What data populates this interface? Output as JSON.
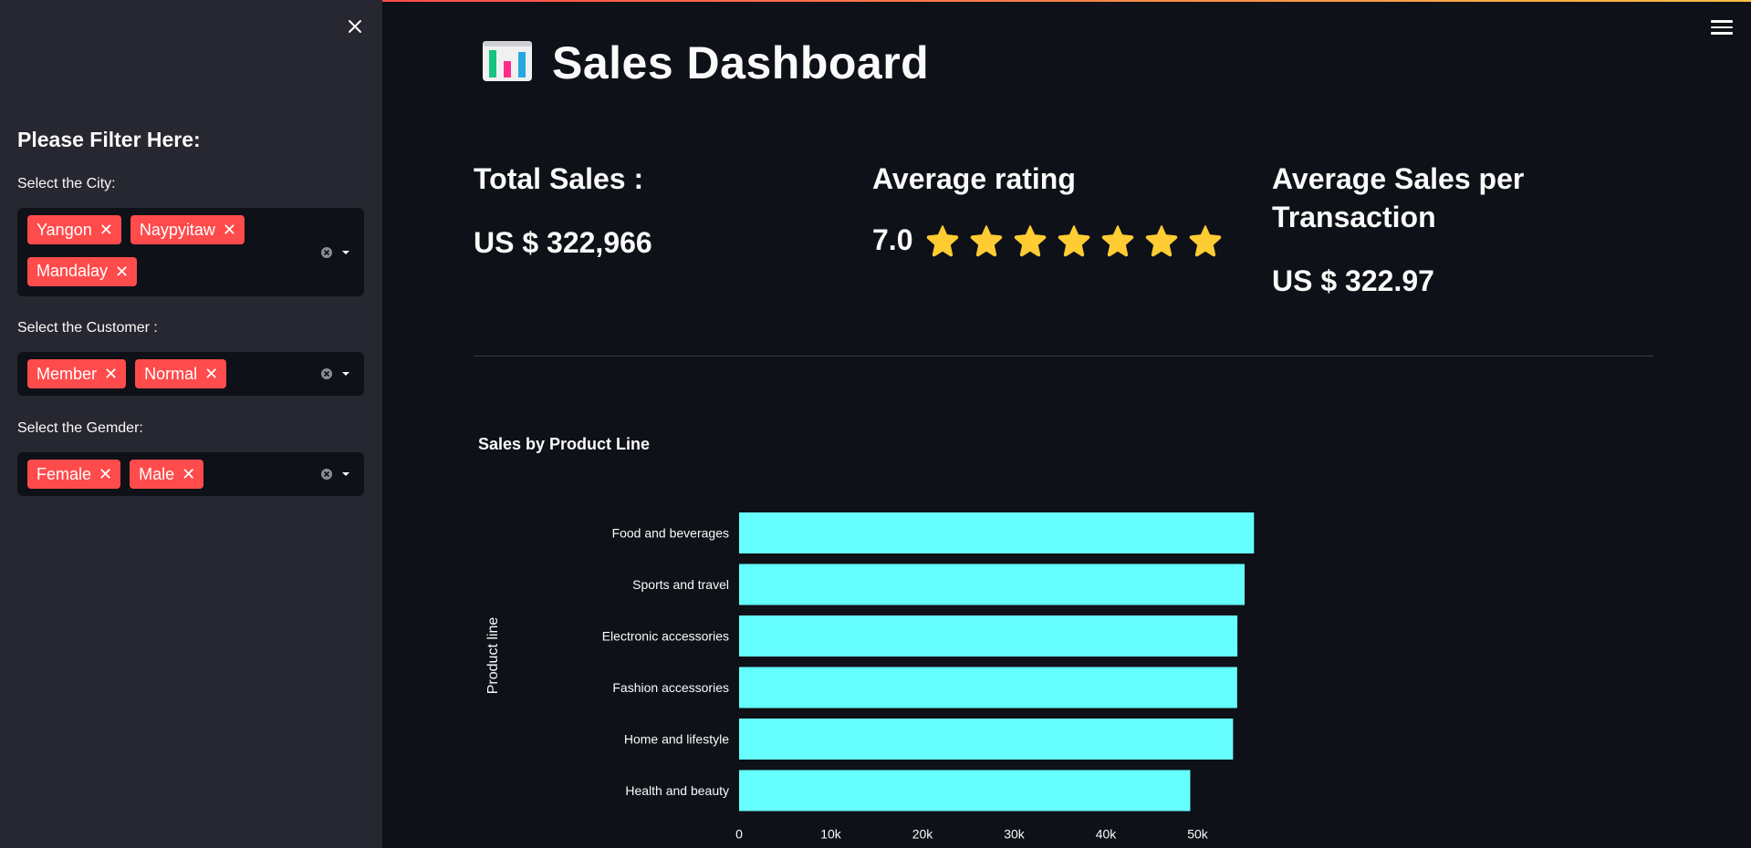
{
  "sidebar": {
    "title": "Please Filter Here:",
    "filters": [
      {
        "label": "Select the City:",
        "tags": [
          "Yangon",
          "Naypyitaw",
          "Mandalay"
        ]
      },
      {
        "label": "Select the Customer :",
        "tags": [
          "Member",
          "Normal"
        ]
      },
      {
        "label": "Select the Gemder:",
        "tags": [
          "Female",
          "Male"
        ]
      }
    ]
  },
  "header": {
    "title": "Sales Dashboard",
    "icon": "bar-chart-emoji-icon"
  },
  "kpis": {
    "total_sales": {
      "heading": "Total Sales :",
      "value": "US $ 322,966"
    },
    "average_rating": {
      "heading": "Average rating",
      "value": "7.0",
      "stars": 7
    },
    "average_sales": {
      "heading_line1": "Average Sales per",
      "heading_line2": "Transaction",
      "value": "US $ 322.97"
    }
  },
  "colors": {
    "accent": "#ff4b4b",
    "bar": "#66ffff",
    "star": "#ffcc33",
    "background": "#0e1117",
    "sidebar": "#262730"
  },
  "chart_data": {
    "type": "bar",
    "orientation": "horizontal",
    "title": "Sales by Product Line",
    "ylabel": "Product line",
    "xlabel": "",
    "categories": [
      "Food and beverages",
      "Sports and travel",
      "Electronic accessories",
      "Fashion accessories",
      "Home and lifestyle",
      "Health and beauty"
    ],
    "values": [
      56145,
      55123,
      54338,
      54306,
      53862,
      49194
    ],
    "xticks": [
      "0",
      "10k",
      "20k",
      "30k",
      "40k",
      "50k"
    ],
    "xtick_values": [
      0,
      10000,
      20000,
      30000,
      40000,
      50000
    ],
    "xlim": [
      0,
      59100
    ],
    "grid": false,
    "legend": "none"
  }
}
